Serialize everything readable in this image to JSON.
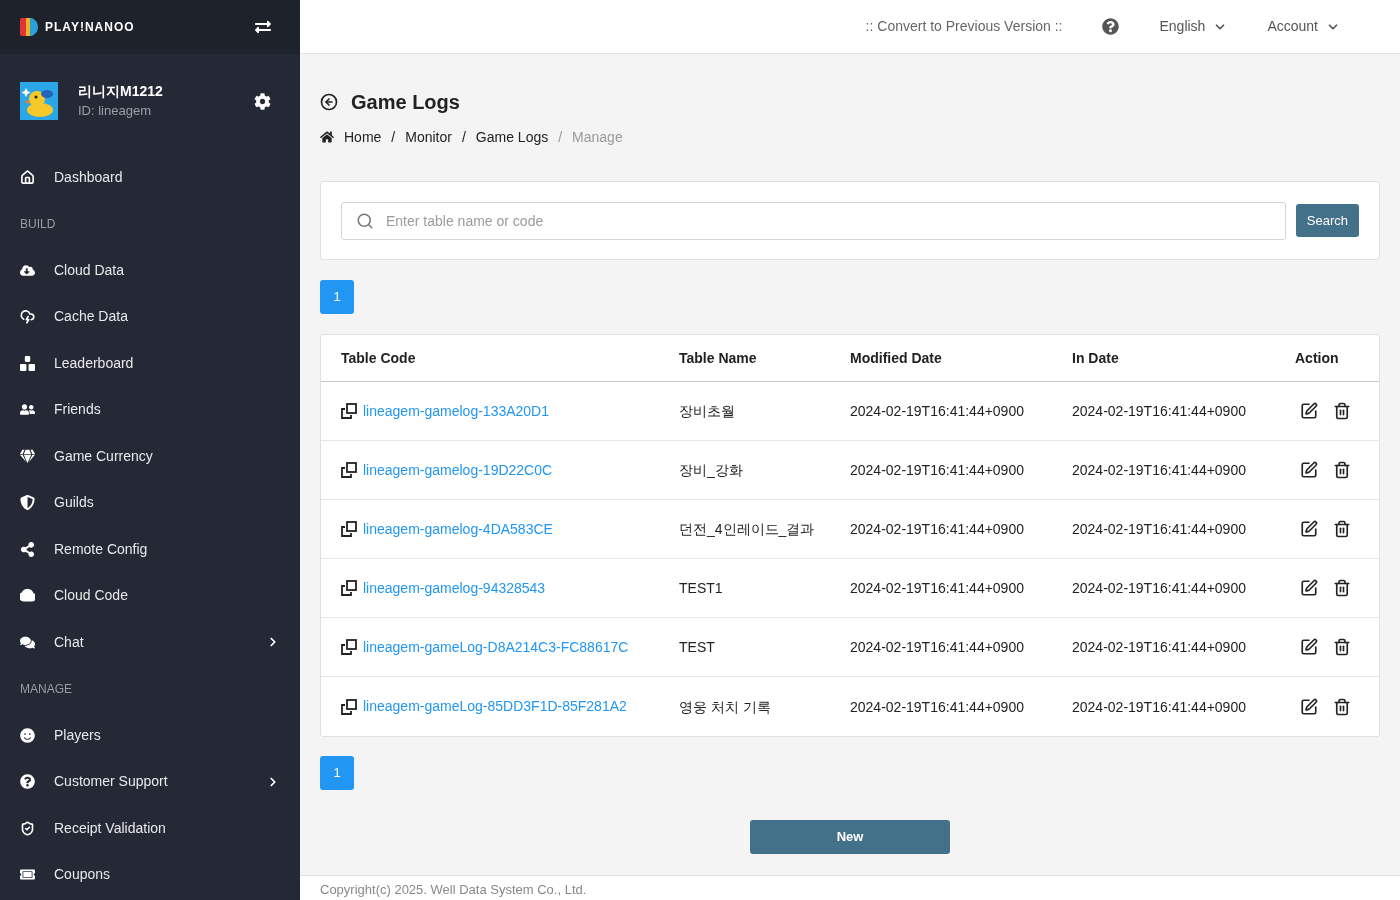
{
  "sidebar": {
    "brand": "PLAY!NANOO",
    "profile": {
      "name": "리니지M1212",
      "id_text": "ID: lineagem"
    },
    "nav": [
      {
        "kind": "link",
        "label": "Dashboard"
      },
      {
        "kind": "header",
        "label": "BUILD"
      },
      {
        "kind": "link",
        "label": "Cloud Data"
      },
      {
        "kind": "link",
        "label": "Cache Data"
      },
      {
        "kind": "link",
        "label": "Leaderboard"
      },
      {
        "kind": "link",
        "label": "Friends"
      },
      {
        "kind": "link",
        "label": "Game Currency"
      },
      {
        "kind": "link",
        "label": "Guilds"
      },
      {
        "kind": "link",
        "label": "Remote Config"
      },
      {
        "kind": "link",
        "label": "Cloud Code"
      },
      {
        "kind": "group",
        "label": "Chat",
        "expanded": false
      },
      {
        "kind": "header",
        "label": "MANAGE"
      },
      {
        "kind": "link",
        "label": "Players"
      },
      {
        "kind": "group",
        "label": "Customer Support",
        "expanded": false
      },
      {
        "kind": "link",
        "label": "Receipt Validation"
      },
      {
        "kind": "link",
        "label": "Coupons"
      }
    ]
  },
  "top_bar": {
    "convert_link": ":: Convert to Previous Version ::",
    "language": "English",
    "account": "Account"
  },
  "page": {
    "title": "Game Logs",
    "breadcrumb": [
      {
        "kind": "link",
        "label": "Home"
      },
      {
        "kind": "separator",
        "label": "/",
        "muted": false
      },
      {
        "kind": "link",
        "label": "Monitor"
      },
      {
        "kind": "separator",
        "label": "/",
        "muted": false
      },
      {
        "kind": "link",
        "label": "Game Logs"
      },
      {
        "kind": "separator",
        "label": "/",
        "muted": true
      },
      {
        "kind": "current",
        "label": "Manage"
      }
    ]
  },
  "search": {
    "placeholder": "Enter table name or code",
    "button": "Search"
  },
  "pagination_top": [
    {
      "label": "1",
      "selected": true
    }
  ],
  "table": {
    "columns": [
      "Table Code",
      "Table Name",
      "Modified Date",
      "In Date",
      "Action"
    ],
    "rows": [
      {
        "table_code": "lineagem-gamelog-133A20D1",
        "table_name": "장비초월",
        "modified_date": "2024-02-19T16:41:44+0900",
        "in_date": "2024-02-19T16:41:44+0900"
      },
      {
        "table_code": "lineagem-gamelog-19D22C0C",
        "table_name": "장비_강화",
        "modified_date": "2024-02-19T16:41:44+0900",
        "in_date": "2024-02-19T16:41:44+0900"
      },
      {
        "table_code": "lineagem-gamelog-4DA583CE",
        "table_name": "던전_4인레이드_결과",
        "modified_date": "2024-02-19T16:41:44+0900",
        "in_date": "2024-02-19T16:41:44+0900"
      },
      {
        "table_code": "lineagem-gamelog-94328543",
        "table_name": "TEST1",
        "modified_date": "2024-02-19T16:41:44+0900",
        "in_date": "2024-02-19T16:41:44+0900"
      },
      {
        "table_code": "lineagem-gameLog-D8A214C3-FC88617C",
        "table_name": "TEST",
        "modified_date": "2024-02-19T16:41:44+0900",
        "in_date": "2024-02-19T16:41:44+0900"
      },
      {
        "table_code": "lineagem-gameLog-85DD3F1D-85F281A2",
        "table_name": "영웅 처치 기록",
        "modified_date": "2024-02-19T16:41:44+0900",
        "in_date": "2024-02-19T16:41:44+0900"
      }
    ]
  },
  "pagination_bottom": [
    {
      "label": "1",
      "selected": true
    }
  ],
  "new_button": "New",
  "footer": "Copyright(c) 2025. Well Data System Co., Ltd."
}
